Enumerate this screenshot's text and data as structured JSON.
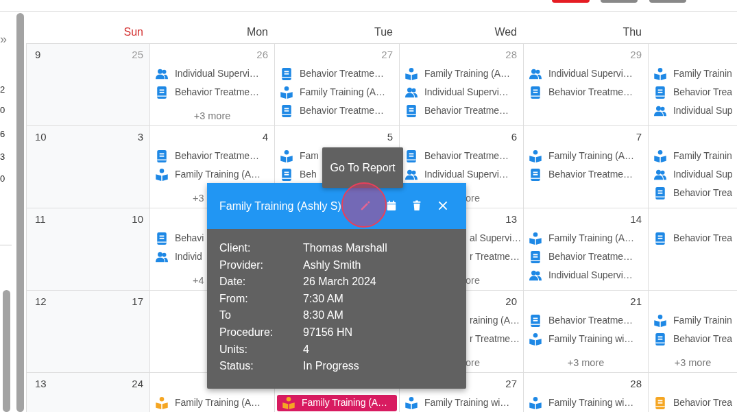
{
  "sidebar": {
    "toggle": "»",
    "items": [
      "2",
      "0",
      "6",
      "3",
      "0"
    ]
  },
  "calendar": {
    "weekdays": [
      {
        "label": "Sun",
        "weekend": true
      },
      {
        "label": "Mon",
        "weekend": false
      },
      {
        "label": "Tue",
        "weekend": false
      },
      {
        "label": "Wed",
        "weekend": false
      },
      {
        "label": "Thu",
        "weekend": false
      }
    ],
    "weeks": [
      {
        "number": "9",
        "days": {
          "sun": {
            "date": "25",
            "other_month": true
          },
          "mon": {
            "date": "26",
            "other_month": true,
            "events": [
              {
                "kind": "group",
                "color": "#1e88e5",
                "text": "Individual Supervi…",
                "selected": false
              },
              {
                "kind": "book",
                "color": "#1e88e5",
                "text": "Behavior Treatme…",
                "selected": false
              }
            ],
            "more": {
              "text": "+3 more"
            }
          },
          "tue": {
            "date": "27",
            "other_month": true,
            "events": [
              {
                "kind": "book",
                "color": "#1e88e5",
                "text": "Behavior Treatme…",
                "selected": false
              },
              {
                "kind": "family",
                "color": "#1e88e5",
                "text": "Family Training (A…",
                "selected": false
              },
              {
                "kind": "book",
                "color": "#1e88e5",
                "text": "Behavior Treatme…",
                "selected": false
              }
            ]
          },
          "wed": {
            "date": "28",
            "other_month": true,
            "events": [
              {
                "kind": "family",
                "color": "#1e88e5",
                "text": "Family Training (A…",
                "selected": false
              },
              {
                "kind": "group",
                "color": "#1e88e5",
                "text": "Individual Supervi…",
                "selected": false
              },
              {
                "kind": "book",
                "color": "#1e88e5",
                "text": "Behavior Treatme…",
                "selected": false
              }
            ]
          },
          "thu": {
            "date": "29",
            "other_month": true,
            "events": [
              {
                "kind": "group",
                "color": "#1e88e5",
                "text": "Individual Supervi…",
                "selected": false
              },
              {
                "kind": "book",
                "color": "#1e88e5",
                "text": "Behavior Treatme…",
                "selected": false
              }
            ]
          },
          "fri": {
            "events": [
              {
                "kind": "family",
                "color": "#1e88e5",
                "text": "Family Trainin",
                "selected": false
              },
              {
                "kind": "book",
                "color": "#1e88e5",
                "text": "Behavior Trea",
                "selected": false
              },
              {
                "kind": "group",
                "color": "#1e88e5",
                "text": "Individual Sup",
                "selected": false
              }
            ]
          }
        }
      },
      {
        "number": "10",
        "days": {
          "sun": {
            "date": "3",
            "other_month": false
          },
          "mon": {
            "date": "4",
            "other_month": false,
            "events": [
              {
                "kind": "book",
                "color": "#1e88e5",
                "text": "Behavior Treatme…",
                "selected": false
              },
              {
                "kind": "family",
                "color": "#1e88e5",
                "text": "Family Training (A…",
                "selected": false
              }
            ],
            "more": {
              "text": "+3",
              "clipped_right": true
            }
          },
          "tue": {
            "date": "5",
            "other_month": false,
            "events": [
              {
                "kind": "family",
                "color": "#1e88e5",
                "text": "Fam",
                "selected": false
              },
              {
                "kind": "book",
                "color": "#1e88e5",
                "text": "Beh",
                "selected": false
              }
            ]
          },
          "wed": {
            "date": "6",
            "other_month": false,
            "events": [
              {
                "kind": "book",
                "color": "#1e88e5",
                "text": "Behavior Treatme…",
                "selected": false
              },
              {
                "kind": "group",
                "color": "#1e88e5",
                "text": "Individual Supervi…",
                "selected": false
              }
            ],
            "more": {
              "text": "ore",
              "clipped_left": true
            }
          },
          "thu": {
            "date": "7",
            "other_month": false,
            "events": [
              {
                "kind": "family",
                "color": "#1e88e5",
                "text": "Family Training (A…",
                "selected": false
              },
              {
                "kind": "book",
                "color": "#1e88e5",
                "text": "Behavior Treatme…",
                "selected": false
              }
            ]
          },
          "fri": {
            "events": [
              {
                "kind": "family",
                "color": "#1e88e5",
                "text": "Family Trainin",
                "selected": false
              },
              {
                "kind": "group",
                "color": "#1e88e5",
                "text": "Individual Sup",
                "selected": false
              },
              {
                "kind": "book",
                "color": "#1e88e5",
                "text": "Behavior Trea",
                "selected": false
              }
            ]
          }
        }
      },
      {
        "number": "11",
        "days": {
          "sun": {
            "date": "10",
            "other_month": false
          },
          "mon": {
            "events": [
              {
                "kind": "book",
                "color": "#1e88e5",
                "text": "Behavi",
                "selected": false
              },
              {
                "kind": "group",
                "color": "#1e88e5",
                "text": "Individ",
                "selected": false
              }
            ],
            "more": {
              "text": "+4",
              "clipped_right": true
            }
          },
          "wed": {
            "date": "13",
            "other_month": false,
            "events": [
              {
                "text": "al Supervi…",
                "clipped_left": true,
                "selected": false
              },
              {
                "text": "r Treatme…",
                "clipped_left": true,
                "selected": false
              }
            ],
            "more": {
              "text": "ore",
              "clipped_left": true
            }
          },
          "thu": {
            "date": "14",
            "other_month": false,
            "events": [
              {
                "kind": "family",
                "color": "#1e88e5",
                "text": "Family Training (A…",
                "selected": false
              },
              {
                "kind": "book",
                "color": "#1e88e5",
                "text": "Behavior Treatme…",
                "selected": false
              },
              {
                "kind": "group",
                "color": "#1e88e5",
                "text": "Individual Supervi…",
                "selected": false
              }
            ]
          },
          "fri": {
            "events": [
              {
                "kind": "book",
                "color": "#1e88e5",
                "text": "Behavior Trea",
                "selected": false
              }
            ]
          }
        }
      },
      {
        "number": "12",
        "days": {
          "sun": {
            "date": "17",
            "other_month": false
          },
          "wed": {
            "date": "20",
            "other_month": false,
            "events": [
              {
                "text": "raining (A…",
                "clipped_left": true,
                "selected": false
              },
              {
                "text": "r Treatme…",
                "clipped_left": true,
                "selected": false
              }
            ],
            "more": {
              "text": "ore",
              "clipped_left": true
            }
          },
          "thu": {
            "date": "21",
            "other_month": false,
            "events": [
              {
                "kind": "book",
                "color": "#1e88e5",
                "text": "Behavior Treatme…",
                "selected": false
              },
              {
                "kind": "family",
                "color": "#1e88e5",
                "text": "Family Training wi…",
                "selected": false
              }
            ],
            "more": {
              "text": "+3 more"
            }
          },
          "fri": {
            "events": [
              {
                "kind": "family",
                "color": "#1e88e5",
                "text": "Family Trainin",
                "selected": false
              },
              {
                "kind": "book",
                "color": "#1e88e5",
                "text": "Behavior Trea",
                "selected": false
              }
            ],
            "more": {
              "text": "+3 more"
            }
          }
        }
      },
      {
        "number": "13",
        "days": {
          "sun": {
            "date": "24",
            "other_month": false
          },
          "mon": {
            "events": [
              {
                "kind": "family",
                "color": "#f5a623",
                "text": "Family Training (A…",
                "selected": false
              }
            ]
          },
          "tue": {
            "events": [
              {
                "kind": "family",
                "color": "#f5a623",
                "text": "Family Training (A…",
                "selected": true
              }
            ]
          },
          "wed": {
            "date": "27",
            "other_month": false,
            "events": [
              {
                "kind": "family",
                "color": "#1e88e5",
                "text": "Family Training wi…",
                "selected": false
              }
            ]
          },
          "thu": {
            "date": "28",
            "other_month": false,
            "events": [
              {
                "kind": "family",
                "color": "#1e88e5",
                "text": "Family Training wi…",
                "selected": false
              }
            ]
          },
          "fri": {
            "events": [
              {
                "kind": "book",
                "color": "#f5a623",
                "text": "Behavior Trea",
                "selected": false
              }
            ]
          }
        }
      }
    ]
  },
  "tooltip": "Go To Report",
  "popup": {
    "title": "Family Training (Ashly S)",
    "actions": [
      {
        "kind": "edit",
        "highlighted": true
      },
      {
        "kind": "calendar",
        "highlighted": false
      },
      {
        "kind": "delete",
        "highlighted": false
      },
      {
        "kind": "close",
        "highlighted": false
      }
    ],
    "fields": [
      {
        "label": "Client:",
        "value": "Thomas Marshall"
      },
      {
        "label": "Provider:",
        "value": "Ashly Smith"
      },
      {
        "label": "Date:",
        "value": "26 March 2024"
      },
      {
        "label": "From:",
        "value": "7:30 AM"
      },
      {
        "label": "To",
        "value": "8:30 AM"
      },
      {
        "label": "Procedure:",
        "value": "97156 HN"
      },
      {
        "label": "Units:",
        "value": "4"
      },
      {
        "label": "Status:",
        "value": "In Progress"
      }
    ]
  }
}
